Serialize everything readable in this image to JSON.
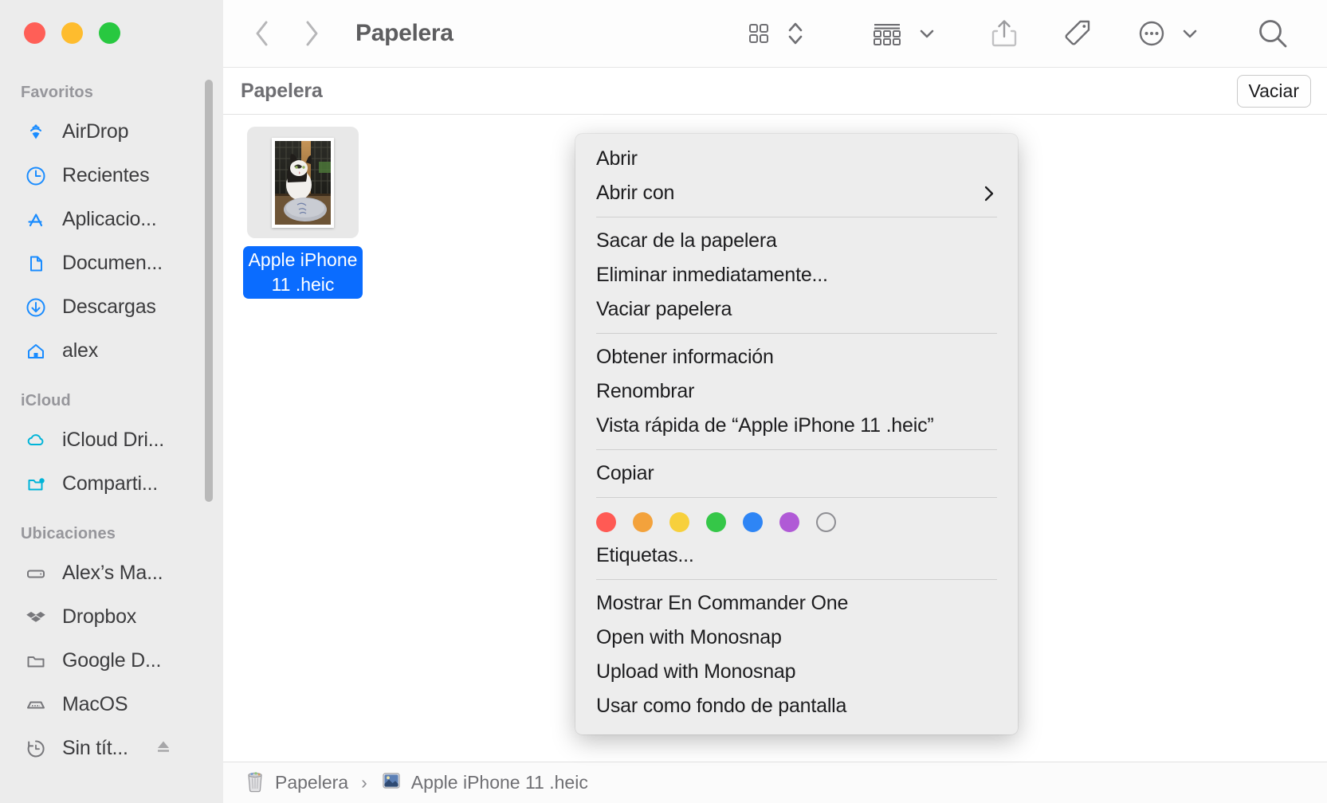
{
  "window": {
    "title": "Papelera",
    "traffic_lights": [
      {
        "name": "close",
        "color": "#ff5f57"
      },
      {
        "name": "minimize",
        "color": "#febc2e"
      },
      {
        "name": "zoom",
        "color": "#28c840"
      }
    ]
  },
  "toolbar": {
    "back_icon": "chevron-left-icon",
    "forward_icon": "chevron-right-icon",
    "view_icon": "icon-view-grid-icon",
    "view_stepper_icon": "chevron-up-down-icon",
    "group_icon": "group-by-icon",
    "group_chevron_icon": "chevron-down-icon",
    "share_icon": "share-icon",
    "tags_icon": "tag-icon",
    "more_icon": "ellipsis-circle-icon",
    "more_chevron_icon": "chevron-down-icon",
    "search_icon": "search-icon"
  },
  "subheader": {
    "title": "Papelera",
    "empty_button": "Vaciar"
  },
  "file": {
    "name": "Apple iPhone 11 .heic",
    "selected": true,
    "thumbnail_alt": "cat-photo-thumbnail",
    "selection_color": "#0a6cff"
  },
  "sidebar": {
    "sections": [
      {
        "title": "Favoritos",
        "items": [
          {
            "label": "AirDrop",
            "icon": "airdrop-icon"
          },
          {
            "label": "Recientes",
            "icon": "clock-icon"
          },
          {
            "label": "Aplicacio...",
            "icon": "applications-icon"
          },
          {
            "label": "Documen...",
            "icon": "document-icon"
          },
          {
            "label": "Descargas",
            "icon": "download-icon"
          },
          {
            "label": "alex",
            "icon": "home-icon"
          }
        ]
      },
      {
        "title": "iCloud",
        "items": [
          {
            "label": "iCloud Dri...",
            "icon": "cloud-icon"
          },
          {
            "label": "Comparti...",
            "icon": "shared-folder-icon"
          }
        ]
      },
      {
        "title": "Ubicaciones",
        "items": [
          {
            "label": "Alex’s Ma...",
            "icon": "laptop-icon"
          },
          {
            "label": "Dropbox",
            "icon": "dropbox-icon"
          },
          {
            "label": "Google D...",
            "icon": "folder-icon"
          },
          {
            "label": "MacOS",
            "icon": "harddisk-icon"
          },
          {
            "label": "Sin tít...",
            "icon": "time-machine-icon",
            "eject": true,
            "eject_icon": "eject-icon"
          }
        ]
      }
    ]
  },
  "context_menu": {
    "groups": [
      {
        "items": [
          {
            "label": "Abrir",
            "submenu": false
          },
          {
            "label": "Abrir con",
            "submenu": true,
            "arrow_icon": "chevron-right-icon"
          }
        ]
      },
      {
        "items": [
          {
            "label": "Sacar de la papelera",
            "submenu": false
          },
          {
            "label": "Eliminar inmediatamente...",
            "submenu": false
          },
          {
            "label": "Vaciar papelera",
            "submenu": false
          }
        ]
      },
      {
        "items": [
          {
            "label": "Obtener información",
            "submenu": false
          },
          {
            "label": "Renombrar",
            "submenu": false
          },
          {
            "label": "Vista rápida de “Apple iPhone 11 .heic”",
            "submenu": false
          }
        ]
      },
      {
        "items": [
          {
            "label": "Copiar",
            "submenu": false
          }
        ]
      },
      {
        "tags": [
          {
            "name": "red",
            "color": "#ff5a54"
          },
          {
            "name": "orange",
            "color": "#f3a23c"
          },
          {
            "name": "yellow",
            "color": "#f7d03c"
          },
          {
            "name": "green",
            "color": "#35c748"
          },
          {
            "name": "blue",
            "color": "#2e85f5"
          },
          {
            "name": "purple",
            "color": "#b05ad6"
          },
          {
            "name": "none",
            "color": "transparent"
          }
        ],
        "items": [
          {
            "label": "Etiquetas...",
            "submenu": false
          }
        ]
      },
      {
        "items": [
          {
            "label": "Mostrar En Commander One",
            "submenu": false
          },
          {
            "label": "Open with Monosnap",
            "submenu": false
          },
          {
            "label": "Upload with Monosnap",
            "submenu": false
          },
          {
            "label": "Usar como fondo de pantalla",
            "submenu": false
          }
        ]
      }
    ]
  },
  "pathbar": {
    "segments": [
      {
        "label": "Papelera",
        "icon": "trash-icon"
      },
      {
        "label": "Apple iPhone 11 .heic",
        "icon": "heic-file-icon"
      }
    ],
    "separator": "›"
  }
}
